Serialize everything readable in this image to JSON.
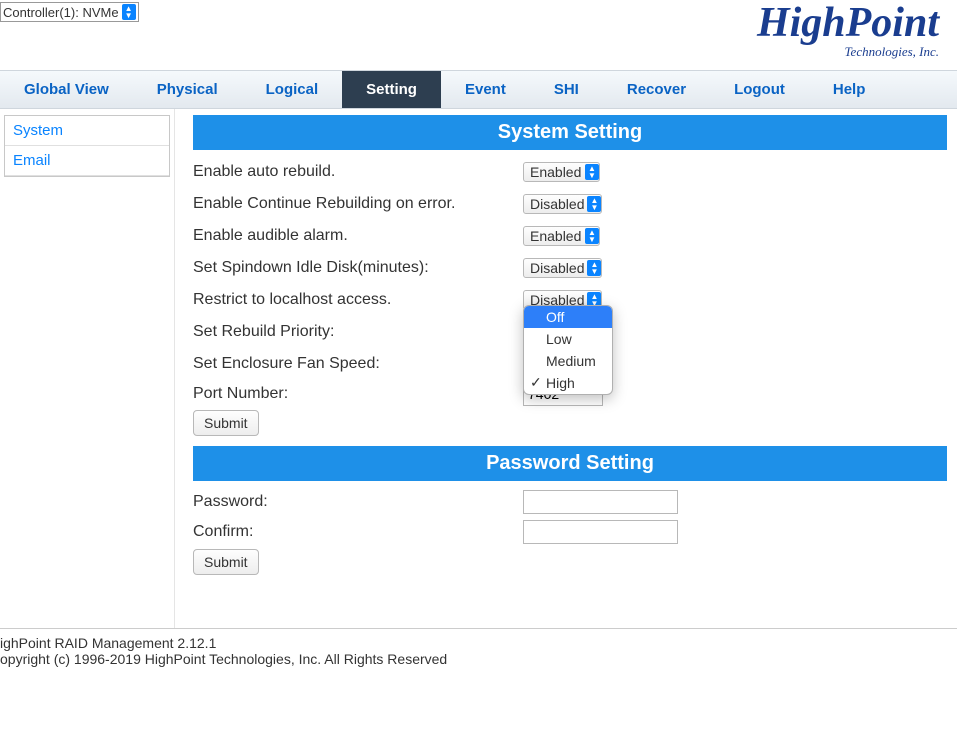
{
  "controller_select": {
    "value": "Controller(1): NVMe"
  },
  "logo": {
    "main": "HighPoint",
    "sub": "Technologies, Inc."
  },
  "nav": {
    "items": [
      {
        "label": "Global View"
      },
      {
        "label": "Physical"
      },
      {
        "label": "Logical"
      },
      {
        "label": "Setting",
        "active": true
      },
      {
        "label": "Event"
      },
      {
        "label": "SHI"
      },
      {
        "label": "Recover"
      },
      {
        "label": "Logout"
      },
      {
        "label": "Help"
      }
    ]
  },
  "sidebar": {
    "items": [
      {
        "label": "System"
      },
      {
        "label": "Email"
      }
    ]
  },
  "sections": {
    "system": {
      "title": "System Setting",
      "rows": [
        {
          "label": "Enable auto rebuild.",
          "value": "Enabled"
        },
        {
          "label": "Enable Continue Rebuilding on error.",
          "value": "Disabled"
        },
        {
          "label": "Enable audible alarm.",
          "value": "Enabled"
        },
        {
          "label": "Set Spindown Idle Disk(minutes):",
          "value": "Disabled"
        },
        {
          "label": "Restrict to localhost access.",
          "value": "Disabled"
        },
        {
          "label": "Set Rebuild Priority:",
          "value": ""
        },
        {
          "label": "Set Enclosure Fan Speed:",
          "value": ""
        }
      ],
      "port": {
        "label": "Port Number:",
        "value": "7402"
      },
      "submit": "Submit"
    },
    "password": {
      "title": "Password Setting",
      "rows": [
        {
          "label": "Password:"
        },
        {
          "label": "Confirm:"
        }
      ],
      "submit": "Submit"
    }
  },
  "dropdown": {
    "options": [
      {
        "label": "Off",
        "highlight": true
      },
      {
        "label": "Low"
      },
      {
        "label": "Medium"
      },
      {
        "label": "High",
        "checked": true
      }
    ]
  },
  "footer": {
    "line1": "ighPoint RAID Management 2.12.1",
    "line2": "opyright (c) 1996-2019 HighPoint Technologies, Inc. All Rights Reserved"
  }
}
